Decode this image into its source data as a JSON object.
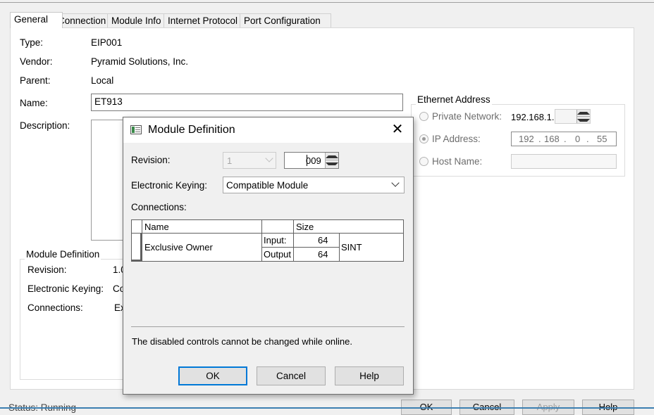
{
  "tabs": [
    {
      "label": "General",
      "active": true
    },
    {
      "label": "Connection"
    },
    {
      "label": "Module Info"
    },
    {
      "label": "Internet Protocol"
    },
    {
      "label": "Port Configuration"
    }
  ],
  "general": {
    "type_label": "Type:",
    "type_value": "EIP001",
    "vendor_label": "Vendor:",
    "vendor_value": "Pyramid Solutions, Inc.",
    "parent_label": "Parent:",
    "parent_value": "Local",
    "name_label": "Name:",
    "name_value": "ET913",
    "description_label": "Description:"
  },
  "ethernet": {
    "title": "Ethernet Address",
    "private_label": "Private Network:",
    "private_prefix": "192.168.1.",
    "ip_label": "IP Address:",
    "ip_octets": [
      "192",
      "168",
      "0",
      "55"
    ],
    "host_label": "Host Name:"
  },
  "module_definition": {
    "title": "Module Definition",
    "revision_label": "Revision:",
    "revision_value": "1.0",
    "keying_label": "Electronic Keying:",
    "keying_value": "Co",
    "connections_label": "Connections:",
    "connections_value": "Ex"
  },
  "bottom": {
    "status_label": "Status: Running",
    "buttons": [
      "OK",
      "Cancel",
      "Apply",
      "Help"
    ]
  },
  "dialog": {
    "title": "Module Definition",
    "close_glyph": "✕",
    "revision_label": "Revision:",
    "revision_major": "1",
    "revision_minor": "009",
    "keying_label": "Electronic Keying:",
    "keying_value": "Compatible Module",
    "connections_label": "Connections:",
    "table": {
      "headers": [
        "Name",
        "",
        "Size"
      ],
      "row_name": "Exclusive Owner",
      "input_label": "Input:",
      "input_value": "64",
      "output_label": "Output",
      "output_value": "64",
      "type": "SINT"
    },
    "note": "The disabled controls cannot be changed while online.",
    "buttons": {
      "ok": "OK",
      "cancel": "Cancel",
      "help": "Help"
    }
  },
  "colors": {
    "accent": "#0078d7",
    "status_bar": "#3c7fb1"
  }
}
